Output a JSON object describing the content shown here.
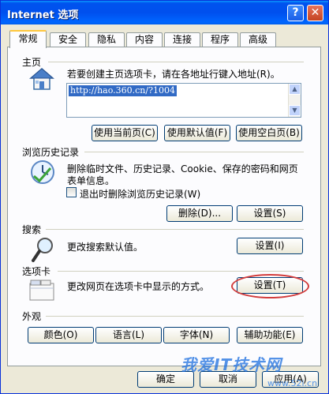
{
  "window": {
    "title": "Internet 选项",
    "help_glyph": "?",
    "close_glyph": "✕"
  },
  "tabs": [
    {
      "label": "常规",
      "active": true
    },
    {
      "label": "安全",
      "active": false
    },
    {
      "label": "隐私",
      "active": false
    },
    {
      "label": "内容",
      "active": false
    },
    {
      "label": "连接",
      "active": false
    },
    {
      "label": "程序",
      "active": false
    },
    {
      "label": "高级",
      "active": false
    }
  ],
  "home": {
    "group_label": "主页",
    "instruction": "若要创建主页选项卡，请在各地址行键入地址(R)。",
    "url": "http://hao.360.cn/?1004",
    "buttons": {
      "use_current": "使用当前页(C)",
      "use_default": "使用默认值(F)",
      "use_blank": "使用空白页(B)"
    }
  },
  "history": {
    "group_label": "浏览历史记录",
    "description_line1": "删除临时文件、历史记录、Cookie、保存的密码和网页",
    "description_line2": "表单信息。",
    "checkbox_label": "退出时删除浏览历史记录(W)",
    "checkbox_checked": false,
    "delete_button": "删除(D)...",
    "settings_button": "设置(S)"
  },
  "search": {
    "group_label": "搜索",
    "description": "更改搜索默认值。",
    "settings_button": "设置(I)"
  },
  "tabbed": {
    "group_label": "选项卡",
    "description": "更改网页在选项卡中显示的方式。",
    "settings_button": "设置(T)"
  },
  "appearance": {
    "group_label": "外观",
    "buttons": {
      "colors": "颜色(O)",
      "languages": "语言(L)",
      "fonts": "字体(N)",
      "accessibility": "辅助功能(E)"
    }
  },
  "footer": {
    "ok": "确定",
    "cancel": "取消",
    "apply": "应用(A)"
  },
  "watermark": {
    "text": "我爱IT技术网",
    "url": "www.52i.cn"
  },
  "colors": {
    "titlebar": "#0053ee",
    "highlight_ring": "#d23c3c",
    "selection": "#316ac5"
  }
}
